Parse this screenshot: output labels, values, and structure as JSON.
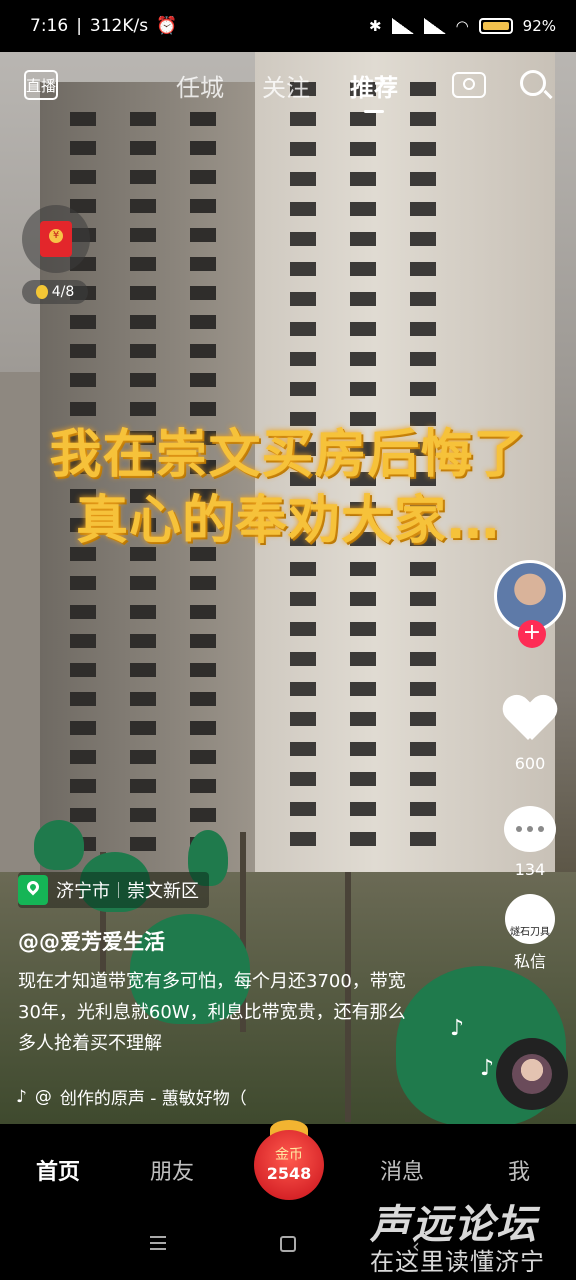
{
  "status_bar": {
    "time": "7:16",
    "speed": "312K/s",
    "battery": "92%",
    "signal_label_1": "HD",
    "signal_label_2": "HD"
  },
  "top_nav": {
    "live_label": "直播",
    "tabs": [
      "任城",
      "关注",
      "推荐"
    ],
    "active_tab": "推荐"
  },
  "red_packet": {
    "progress": "4/8"
  },
  "video_overlay": {
    "line1": "我在崇文买房后悔了",
    "line2": "真心的奉劝大家…"
  },
  "side_actions": {
    "likes": "600",
    "comments": "134",
    "dm_label": "私信",
    "dm_avatar_text": "燧石刀具"
  },
  "location": {
    "city": "济宁市",
    "district": "崇文新区"
  },
  "author": "@@爱芳爱生活",
  "description": "现在才知道带宽有多可怕，每个月还3700，带宽30年，光利息就60W，利息比带宽贵，还有那么多人抢着买不理解",
  "music": "创作的原声 - 蕙敏好物（",
  "music_prefix": "@",
  "bottom_nav": {
    "home": "首页",
    "friends": "朋友",
    "messages": "消息",
    "me": "我",
    "gold_label": "金币",
    "gold_count": "2548"
  },
  "watermark": {
    "line1": "声远论坛",
    "line2": "在这里读懂济宁"
  },
  "colors": {
    "accent": "#fe2c55",
    "overlay_text": "#f6c23a",
    "location_pin": "#15b556"
  }
}
